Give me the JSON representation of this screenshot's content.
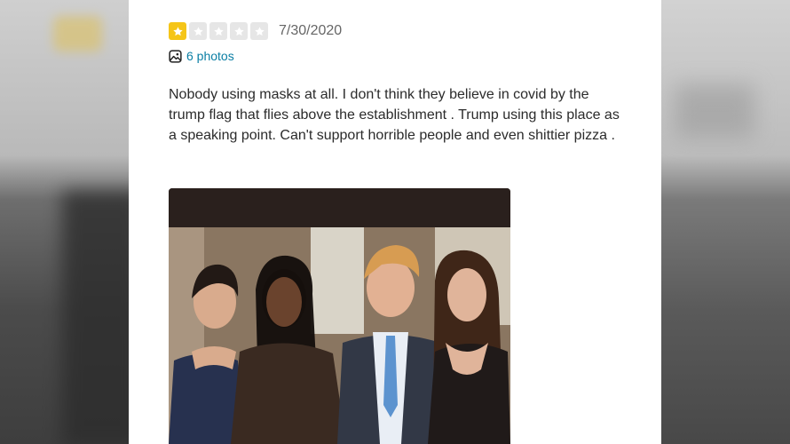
{
  "review": {
    "rating": 1,
    "max_rating": 5,
    "date": "7/30/2020",
    "photos_label": "6 photos",
    "text": "Nobody using masks at all. I don't think they believe in covid by the trump flag that flies above the establishment . Trump using this place as a speaking point. Can't support horrible people and even shittier pizza ."
  },
  "icons": {
    "star": "star-icon",
    "photo": "photo-icon"
  },
  "colors": {
    "star_active": "#f5c518",
    "star_inactive": "#e6e6e6",
    "link": "#0a7ea4"
  }
}
